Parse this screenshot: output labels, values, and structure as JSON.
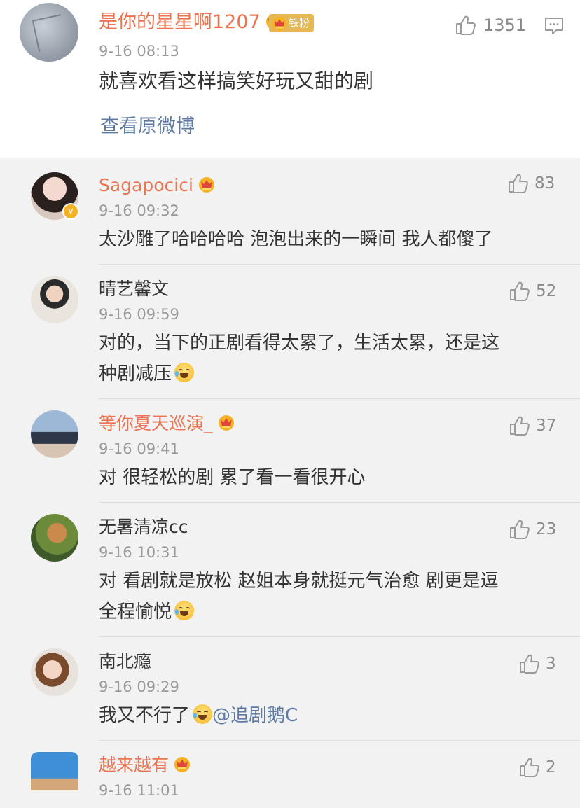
{
  "main_comment": {
    "username": "是你的星星啊1207",
    "fan_badge": "铁粉",
    "time": "9-16 08:13",
    "text": "就喜欢看这样搞笑好玩又甜的剧",
    "likes": "1351",
    "view_original": "查看原微博"
  },
  "replies": [
    {
      "username": "Sagapocici",
      "time": "9-16 09:32",
      "text": "太沙雕了哈哈哈哈  泡泡出来的一瞬间 我人都傻了",
      "likes": "83",
      "name_color": "#eb7350"
    },
    {
      "username": "晴艺馨文",
      "time": "9-16 09:59",
      "text_line1": "对的，当下的正剧看得太累了，生活太累，还是这",
      "text_line2": "种剧减压",
      "likes": "52",
      "name_color": "#333333"
    },
    {
      "username": "等你夏天巡演_",
      "time": "9-16 09:41",
      "text": "对 很轻松的剧 累了看一看很开心",
      "likes": "37",
      "name_color": "#eb7350"
    },
    {
      "username": "无暑清凉cc",
      "time": "9-16 10:31",
      "text_line1": "对 看剧就是放松 赵姐本身就挺元气治愈 剧更是逗",
      "text_line2": "全程愉悦",
      "likes": "23",
      "name_color": "#333333"
    },
    {
      "username": "南北瘾",
      "time": "9-16 09:29",
      "text": "我又不行了",
      "mention": "@追剧鹅C",
      "likes": "3",
      "name_color": "#333333"
    },
    {
      "username": "越来越有",
      "time": "9-16 11:01",
      "likes": "2",
      "name_color": "#eb7350"
    }
  ],
  "icons": {
    "like": "thumb-up-icon",
    "comment": "comment-icon",
    "crown": "crown-badge-icon",
    "verified": "verified-icon",
    "emoji": "laugh-cry-emoji-icon"
  },
  "colors": {
    "accent_orange": "#eb7350",
    "link_blue": "#5e7aa3",
    "badge_gold": "#e6b855",
    "text_gray": "#999999"
  }
}
